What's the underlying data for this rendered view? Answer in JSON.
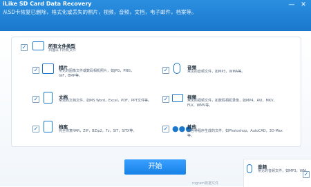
{
  "app": {
    "title": "iLike SD Card Data Recovery",
    "subtitle": "从SD卡恢复已删除，格式化或丢失的照片，视频，音频，文档，电子邮件，档案等。",
    "win_min": "—",
    "win_close": "✕"
  },
  "all_types": {
    "title": "所有文件类型",
    "desc": "扫描以下所有文件"
  },
  "types": [
    {
      "key": "photo",
      "title": "相片",
      "desc": "常见的图像文件或数码相机照片，如JPG，PNG，GIF，BMP等。"
    },
    {
      "key": "audio",
      "title": "音频",
      "desc": "常见的音频文件，如MP3，WMA等。"
    },
    {
      "key": "document",
      "title": "文档",
      "desc": "常见的文档文件，如MS Word，Excel，PDF，PPT文件等。"
    },
    {
      "key": "video",
      "title": "视频",
      "desc": "常见的视频文件，如数码相机录像，如MP4，AVI，MKV，FLV，WMV等。"
    },
    {
      "key": "archive",
      "title": "档案",
      "desc": "完全恢复RAR，ZIP，BZip2，7z，SIT，SITX等。"
    },
    {
      "key": "other",
      "title": "其他",
      "desc": "由各种程序生成的文件，如Photoshop，AutoCAD，3D-Max等。"
    }
  ],
  "start_button": "开始",
  "popup": {
    "title": "音频",
    "desc": "常见的音频文件，如MP3，WM…"
  },
  "watermark": "rogram数据文件"
}
